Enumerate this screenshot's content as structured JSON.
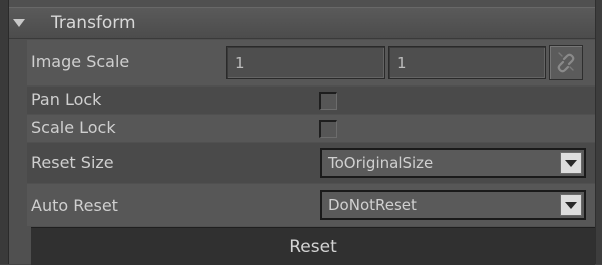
{
  "panel": {
    "title": "Transform",
    "rows": {
      "image_scale": {
        "label": "Image Scale",
        "x_value": "1",
        "y_value": "1",
        "link_icon": "chain-link-icon"
      },
      "pan_lock": {
        "label": "Pan Lock",
        "checked": false
      },
      "scale_lock": {
        "label": "Scale Lock",
        "checked": false
      },
      "reset_size": {
        "label": "Reset Size",
        "selected": "ToOriginalSize"
      },
      "auto_reset": {
        "label": "Auto Reset",
        "selected": "DoNotReset"
      }
    },
    "reset_button": "Reset"
  },
  "colors": {
    "panel_bg": "#505050",
    "header_bg": "#545454",
    "button_bg": "#303030"
  }
}
